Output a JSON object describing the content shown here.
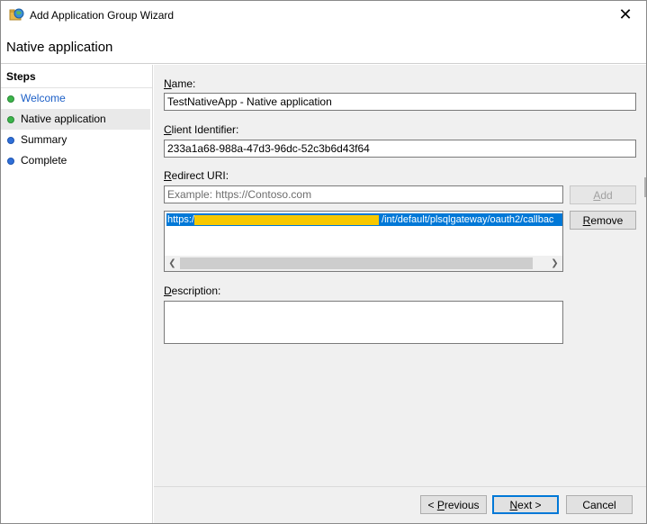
{
  "window": {
    "title": "Add Application Group Wizard",
    "close_glyph": "✕"
  },
  "header": {
    "page_title": "Native application"
  },
  "steps": {
    "title": "Steps",
    "items": [
      {
        "label": "Welcome",
        "status": "completed",
        "style": "link"
      },
      {
        "label": "Native application",
        "status": "completed",
        "style": "current"
      },
      {
        "label": "Summary",
        "status": "pending",
        "style": "normal"
      },
      {
        "label": "Complete",
        "status": "pending",
        "style": "normal"
      }
    ]
  },
  "form": {
    "name_label_key": "N",
    "name_label_rest": "ame:",
    "name_value": "TestNativeApp - Native application",
    "client_id_label_key": "C",
    "client_id_label_rest": "lient Identifier:",
    "client_id_value": "233a1a68-988a-47d3-96dc-52c3b6d43f64",
    "redirect_label_key": "R",
    "redirect_label_rest": "edirect URI:",
    "redirect_placeholder": "Example: https://Contoso.com",
    "redirect_entries": [
      {
        "prefix": "https://",
        "suffix": "/int/default/plsqlgateway/oauth2/callbac",
        "redacted": true
      }
    ],
    "description_label_key": "D",
    "description_label_rest": "escription:",
    "description_value": ""
  },
  "buttons": {
    "add_key": "A",
    "add_rest": "dd",
    "remove_key": "R",
    "remove_rest": "emove",
    "previous_prefix": "< ",
    "previous_key": "P",
    "previous_rest": "revious",
    "next_key": "N",
    "next_rest": "ext >",
    "cancel": "Cancel"
  },
  "colors": {
    "selection": "#0078d7",
    "completed_dot": "#3bb54a",
    "pending_dot": "#2f6fd8",
    "link_text": "#1c5fc7",
    "redaction": "#f7c800",
    "content_bg": "#f0f0f0"
  },
  "icons": {
    "app": "folder-globe-icon",
    "close": "close-icon",
    "scroll_left": "chevron-left-icon",
    "scroll_right": "chevron-right-icon"
  }
}
